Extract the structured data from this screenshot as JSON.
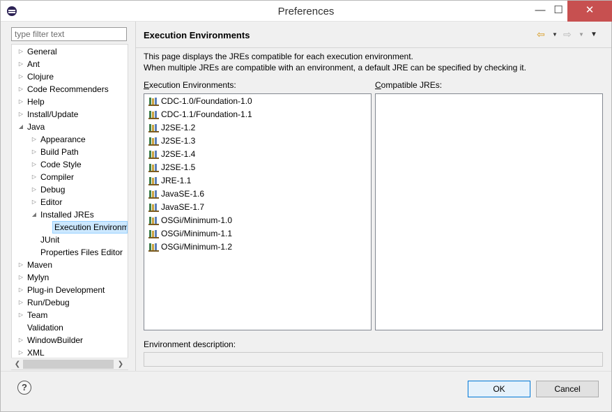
{
  "window": {
    "title": "Preferences",
    "minimize": "—",
    "maximize": "☐",
    "close": "✕"
  },
  "filter": {
    "placeholder": "type filter text",
    "value": ""
  },
  "tree": [
    {
      "label": "General",
      "level": 0,
      "state": "collapsed"
    },
    {
      "label": "Ant",
      "level": 0,
      "state": "collapsed"
    },
    {
      "label": "Clojure",
      "level": 0,
      "state": "collapsed"
    },
    {
      "label": "Code Recommenders",
      "level": 0,
      "state": "collapsed"
    },
    {
      "label": "Help",
      "level": 0,
      "state": "collapsed"
    },
    {
      "label": "Install/Update",
      "level": 0,
      "state": "collapsed"
    },
    {
      "label": "Java",
      "level": 0,
      "state": "expanded"
    },
    {
      "label": "Appearance",
      "level": 1,
      "state": "collapsed"
    },
    {
      "label": "Build Path",
      "level": 1,
      "state": "collapsed"
    },
    {
      "label": "Code Style",
      "level": 1,
      "state": "collapsed"
    },
    {
      "label": "Compiler",
      "level": 1,
      "state": "collapsed"
    },
    {
      "label": "Debug",
      "level": 1,
      "state": "collapsed"
    },
    {
      "label": "Editor",
      "level": 1,
      "state": "collapsed"
    },
    {
      "label": "Installed JREs",
      "level": 1,
      "state": "expanded"
    },
    {
      "label": "Execution Environments",
      "level": 2,
      "state": "leaf",
      "selected": true
    },
    {
      "label": "JUnit",
      "level": 1,
      "state": "leaf"
    },
    {
      "label": "Properties Files Editor",
      "level": 1,
      "state": "leaf"
    },
    {
      "label": "Maven",
      "level": 0,
      "state": "collapsed"
    },
    {
      "label": "Mylyn",
      "level": 0,
      "state": "collapsed"
    },
    {
      "label": "Plug-in Development",
      "level": 0,
      "state": "collapsed"
    },
    {
      "label": "Run/Debug",
      "level": 0,
      "state": "collapsed"
    },
    {
      "label": "Team",
      "level": 0,
      "state": "collapsed"
    },
    {
      "label": "Validation",
      "level": 0,
      "state": "leaf"
    },
    {
      "label": "WindowBuilder",
      "level": 0,
      "state": "collapsed"
    },
    {
      "label": "XML",
      "level": 0,
      "state": "collapsed"
    }
  ],
  "page": {
    "title": "Execution Environments",
    "description_line1": "This page displays the JREs compatible for each execution environment.",
    "description_line2": "When multiple JREs are compatible with an environment, a default JRE can be specified by checking it.",
    "env_label_mnemonic": "E",
    "env_label_rest": "xecution Environments:",
    "jre_label_mnemonic": "C",
    "jre_label_rest": "ompatible JREs:",
    "environments": [
      "CDC-1.0/Foundation-1.0",
      "CDC-1.1/Foundation-1.1",
      "J2SE-1.2",
      "J2SE-1.3",
      "J2SE-1.4",
      "J2SE-1.5",
      "JRE-1.1",
      "JavaSE-1.6",
      "JavaSE-1.7",
      "OSGi/Minimum-1.0",
      "OSGi/Minimum-1.1",
      "OSGi/Minimum-1.2"
    ],
    "compatible_jres": [],
    "environment_description_label": "Environment description:",
    "environment_description_value": ""
  },
  "nav": {
    "back_icon": "back-arrow-icon",
    "forward_icon": "forward-arrow-icon",
    "menu_icon": "view-menu-icon"
  },
  "buttons": {
    "help": "?",
    "ok": "OK",
    "cancel": "Cancel"
  },
  "colors": {
    "selection_bg": "#cce8ff",
    "close_button": "#c75050",
    "ok_border": "#0078d7",
    "back_arrow": "#d79a1f"
  }
}
